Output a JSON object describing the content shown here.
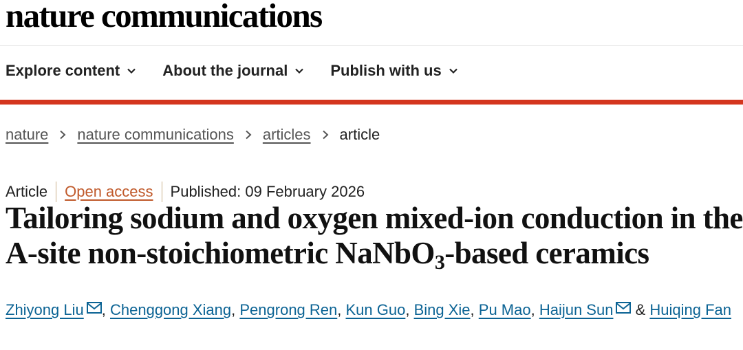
{
  "brand": {
    "name": "nature communications"
  },
  "nav": {
    "items": [
      {
        "label": "Explore content"
      },
      {
        "label": "About the journal"
      },
      {
        "label": "Publish with us"
      }
    ]
  },
  "breadcrumb": {
    "items": [
      {
        "label": "nature"
      },
      {
        "label": "nature communications"
      },
      {
        "label": "articles"
      },
      {
        "label": "article"
      }
    ]
  },
  "article": {
    "type": "Article",
    "access": "Open access",
    "published": "Published: 09 February 2026",
    "title_part1": "Tailoring sodium and oxygen mixed-ion conduction in the A-site non-stoichiometric NaNbO",
    "title_sub": "3",
    "title_part2": "-based ceramics",
    "authors": [
      {
        "name": "Zhiyong Liu"
      },
      {
        "name": "Chenggong Xiang"
      },
      {
        "name": "Pengrong Ren"
      },
      {
        "name": "Kun Guo"
      },
      {
        "name": "Bing Xie"
      },
      {
        "name": "Pu Mao"
      },
      {
        "name": "Haijun Sun"
      },
      {
        "name": "Huiqing Fan"
      }
    ],
    "author_sep": ", ",
    "author_amp": " & "
  },
  "colors": {
    "accent_red": "#d4361e",
    "link_blue": "#0b6394",
    "open_access": "#c0592a"
  },
  "icons": {
    "mail": "envelope-icon",
    "chevron": "chevron-down-icon",
    "crumb_sep": "chevron-right-icon"
  }
}
